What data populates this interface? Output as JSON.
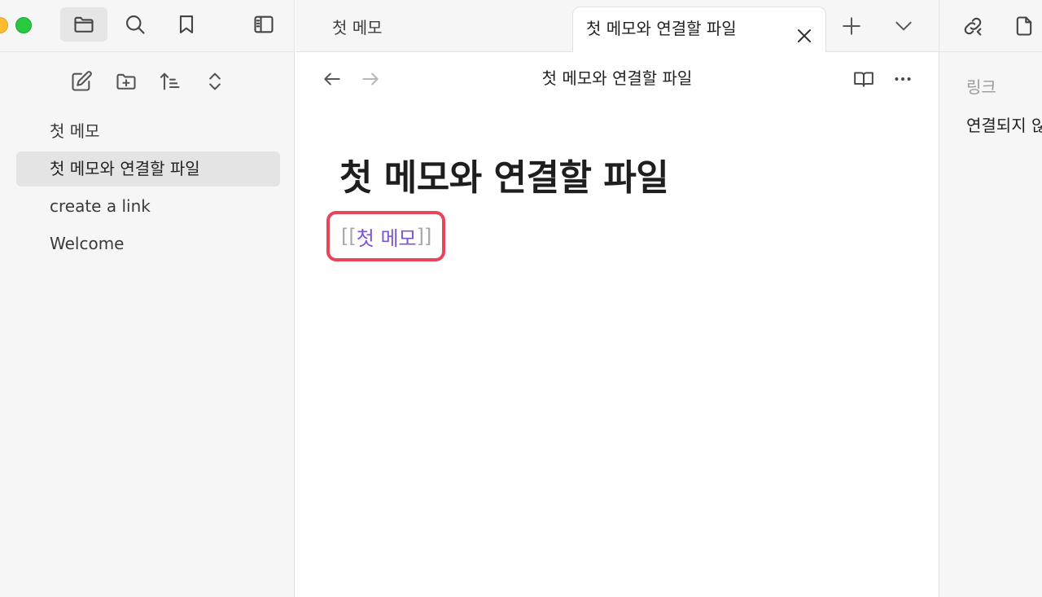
{
  "sidebar": {
    "files": [
      {
        "label": "첫 메모",
        "active": false
      },
      {
        "label": "첫 메모와 연결할 파일",
        "active": true
      },
      {
        "label": "create a link",
        "active": false
      },
      {
        "label": "Welcome",
        "active": false
      }
    ]
  },
  "tabs": [
    {
      "label": "첫 메모",
      "active": false
    },
    {
      "label": "첫 메모와 연결할 파일",
      "active": true
    }
  ],
  "editor": {
    "view_title": "첫 메모와 연결할 파일",
    "note_title": "첫 메모와 연결할 파일",
    "link": {
      "open_bracket": "[[",
      "target": "첫 메모",
      "close_bracket": "]]"
    }
  },
  "right_panel": {
    "links_label": "링크",
    "unlinked_label": "연결되지 않"
  },
  "colors": {
    "link": "#7a55d3",
    "highlight_border": "#e8445a",
    "sidebar_bg": "#f6f6f6",
    "active_item_bg": "#e4e4e4"
  },
  "icons": {
    "sidebar_header": [
      "folder-icon",
      "search-icon",
      "bookmark-icon",
      "sidebar-toggle-icon"
    ],
    "sidebar_actions": [
      "new-note-icon",
      "new-folder-icon",
      "sort-icon",
      "collapse-icon"
    ],
    "tab_actions": [
      "close-icon",
      "plus-icon",
      "chevron-down-icon"
    ],
    "view_actions": [
      "arrow-left-icon",
      "arrow-right-icon",
      "reading-view-icon",
      "more-options-icon"
    ],
    "right_header": [
      "backlinks-icon",
      "file-icon"
    ]
  }
}
